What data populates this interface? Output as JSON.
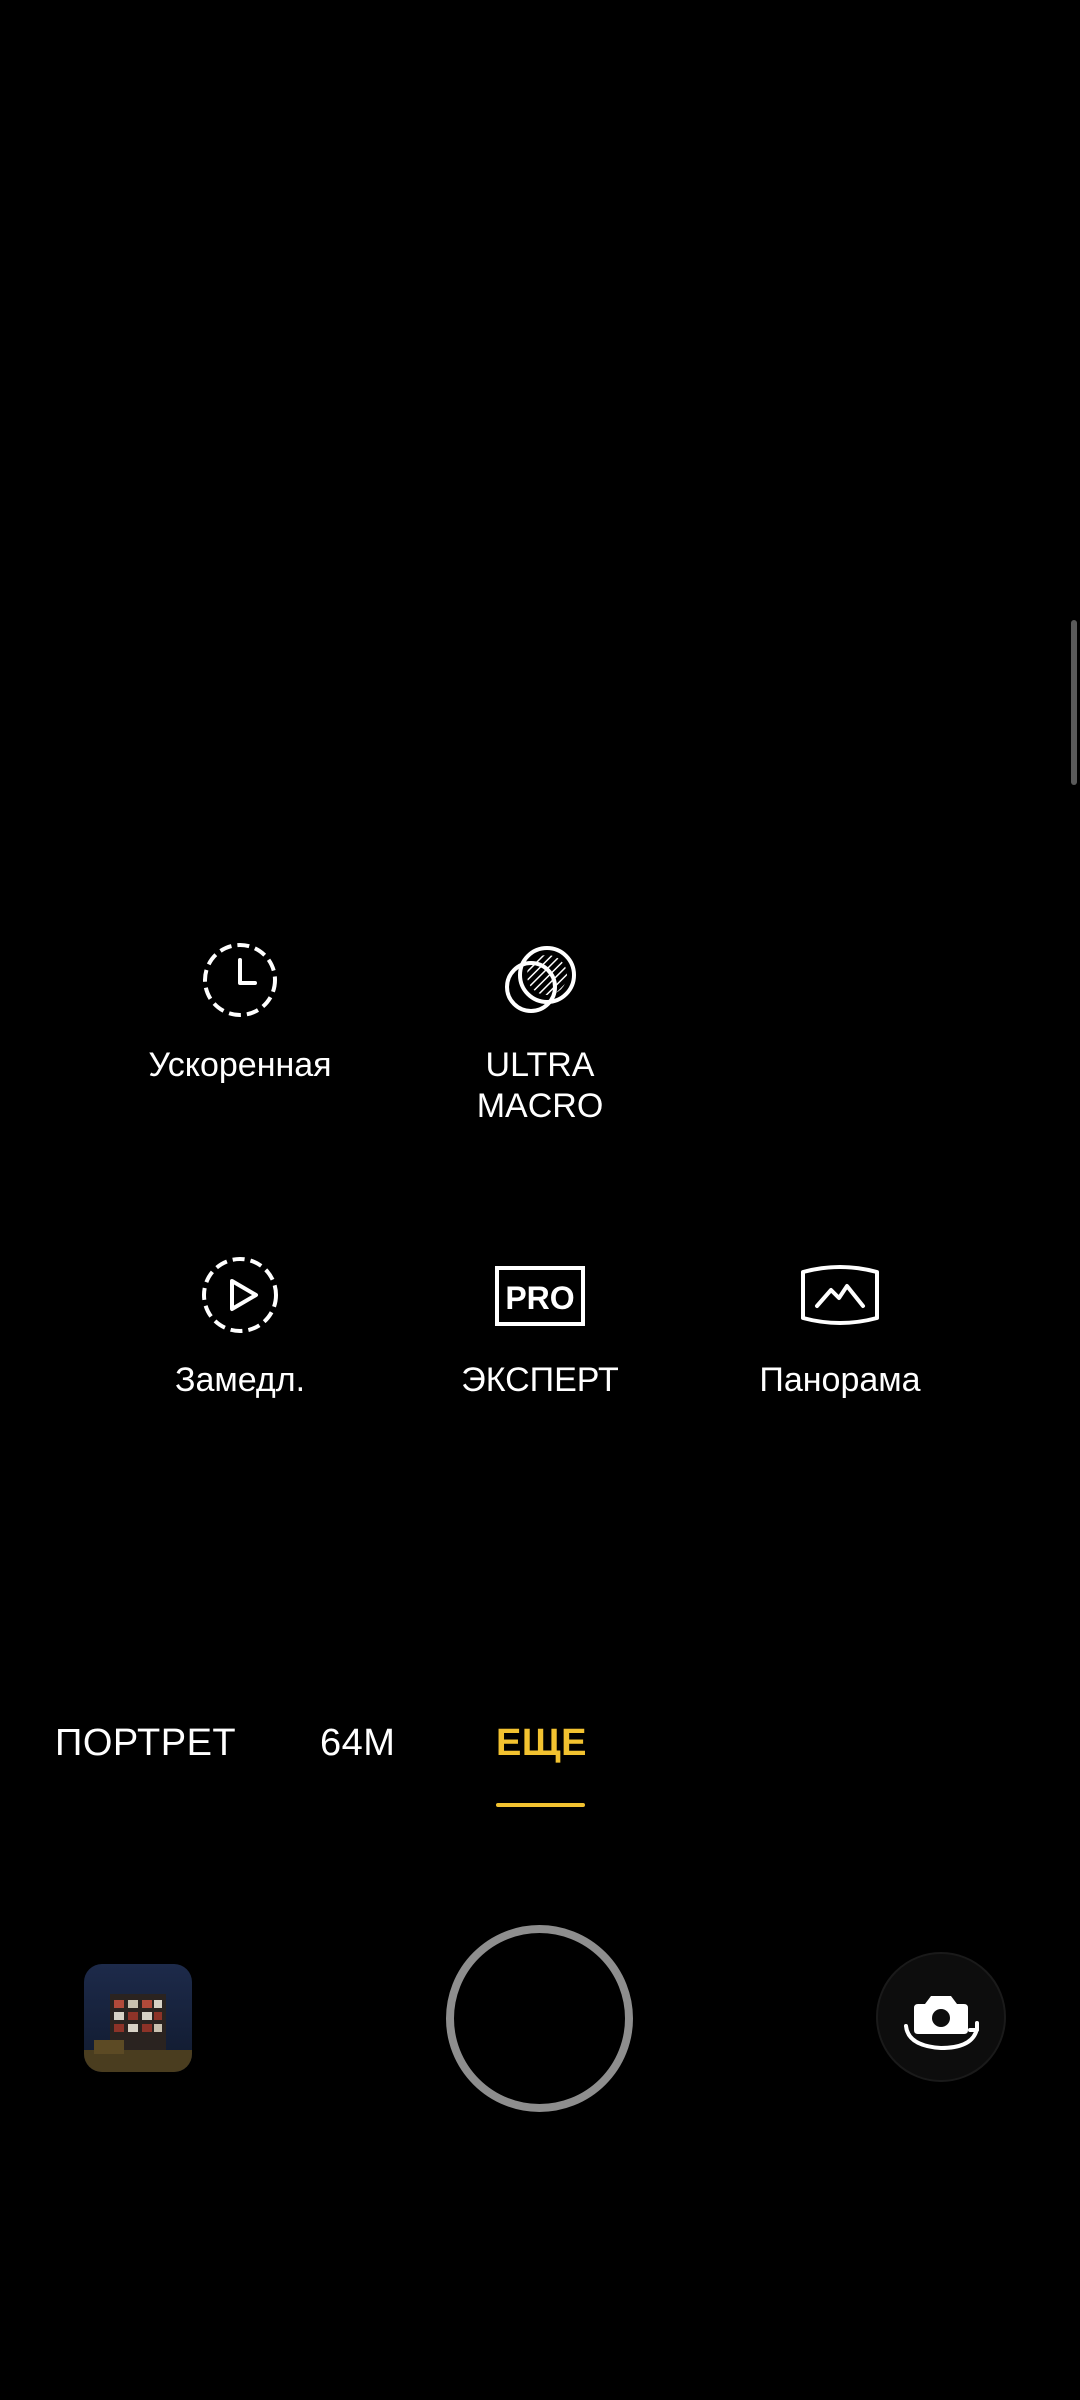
{
  "modes": [
    {
      "id": "timelapse",
      "label": "Ускоренная",
      "icon": "timelapse-icon"
    },
    {
      "id": "ultra-macro",
      "label": "ULTRA\nMACRO",
      "icon": "ultra-macro-icon"
    },
    {
      "id": "slow-motion",
      "label": "Замедл.",
      "icon": "slow-motion-icon"
    },
    {
      "id": "expert",
      "label": "ЭКСПЕРТ",
      "icon": "pro-icon",
      "icon_text": "PRO"
    },
    {
      "id": "panorama",
      "label": "Панорама",
      "icon": "panorama-icon"
    }
  ],
  "tabs": [
    {
      "label": "ПОРТРЕТ",
      "active": false
    },
    {
      "label": "64M",
      "active": false
    },
    {
      "label": "ЕЩЕ",
      "active": true
    }
  ],
  "colors": {
    "accent": "#f2c230",
    "background": "#000000",
    "shutter_ring": "#8e8e8e"
  },
  "controls": {
    "gallery": "gallery-thumbnail",
    "shutter": "shutter-button",
    "switch_camera": "switch-camera-icon"
  }
}
